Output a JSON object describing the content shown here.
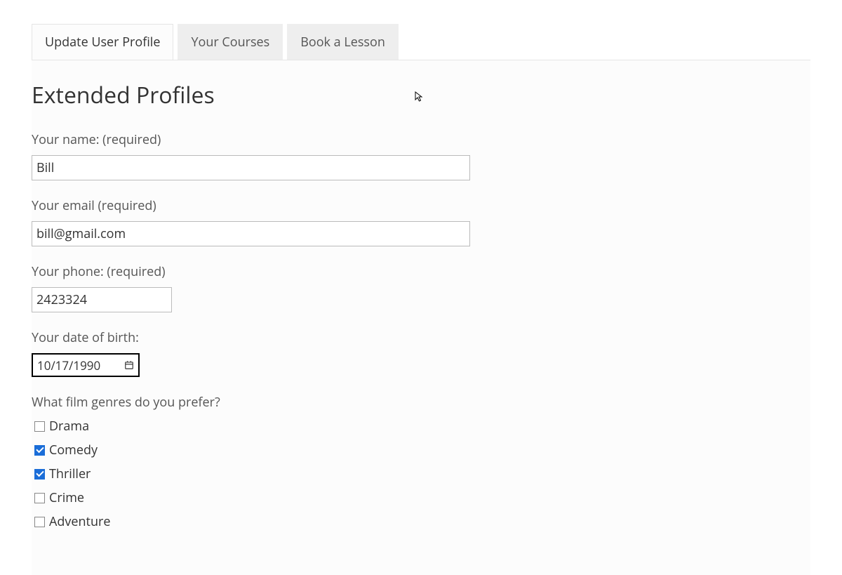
{
  "tabs": [
    {
      "label": "Update User Profile",
      "active": true
    },
    {
      "label": "Your Courses",
      "active": false
    },
    {
      "label": "Book a Lesson",
      "active": false
    }
  ],
  "section_title": "Extended Profiles",
  "form": {
    "name": {
      "label": "Your name: (required)",
      "value": "Bill"
    },
    "email": {
      "label": "Your email (required)",
      "value": "bill@gmail.com"
    },
    "phone": {
      "label": "Your phone: (required)",
      "value": "2423324"
    },
    "dob": {
      "label": "Your date of birth:",
      "value": "10/17/1990"
    },
    "genres": {
      "label": "What film genres do you prefer?",
      "options": [
        {
          "label": "Drama",
          "checked": false
        },
        {
          "label": "Comedy",
          "checked": true
        },
        {
          "label": "Thriller",
          "checked": true
        },
        {
          "label": "Crime",
          "checked": false
        },
        {
          "label": "Adventure",
          "checked": false
        }
      ]
    }
  }
}
